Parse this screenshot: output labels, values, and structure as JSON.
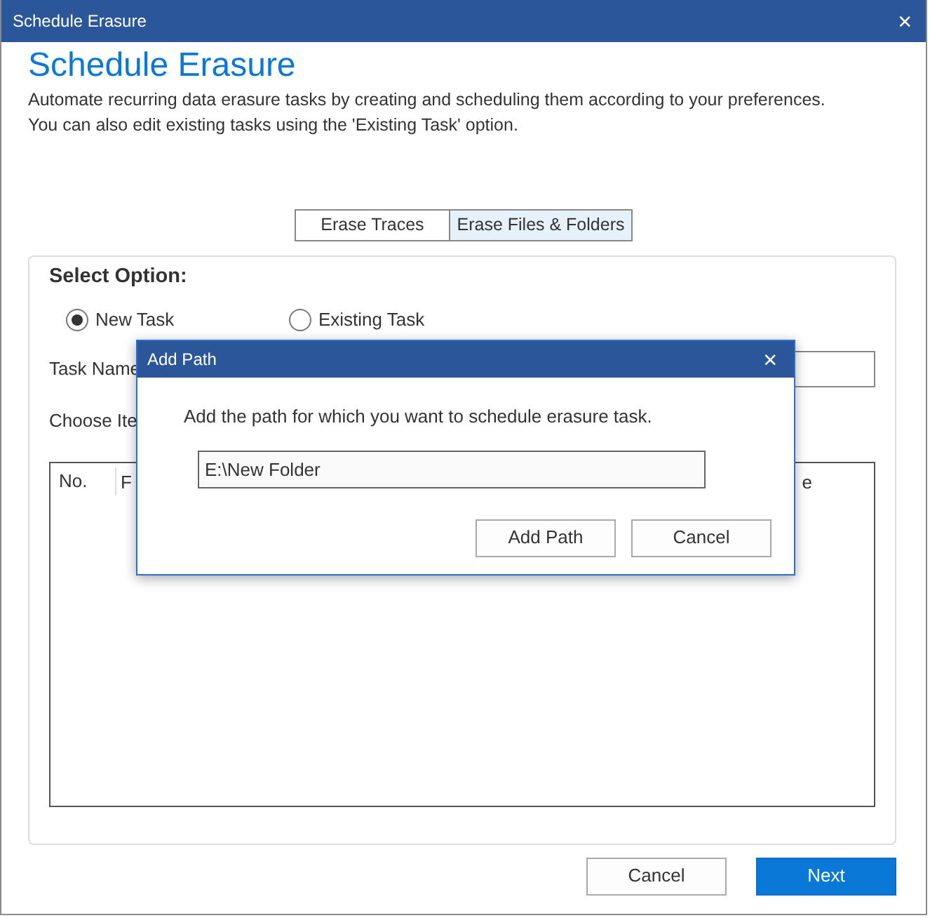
{
  "window": {
    "title": "Schedule Erasure",
    "close": "×"
  },
  "heading": "Schedule Erasure",
  "description": [
    "Automate recurring data erasure tasks by creating and scheduling them according to your preferences.",
    "You can also edit existing tasks using the 'Existing Task' option."
  ],
  "tabs": [
    {
      "label": "Erase Traces",
      "selected": false
    },
    {
      "label": "Erase Files & Folders",
      "selected": true
    }
  ],
  "panel": {
    "title": "Select Option:",
    "options": [
      {
        "label": "New Task",
        "selected": true
      },
      {
        "label": "Existing Task",
        "selected": false
      }
    ],
    "task_name_label": "Task Name",
    "choose_label": "Choose Ite",
    "table": {
      "columns": [
        "No.",
        "F",
        "e"
      ]
    }
  },
  "buttons": [
    {
      "label": "Cancel",
      "kind": "secondary"
    },
    {
      "label": "Next",
      "kind": "primary"
    }
  ],
  "dialog": {
    "title": "Add Path",
    "close": "×",
    "message": "Add the path for which you want to schedule erasure task.",
    "path": "E:\\New Folder",
    "buttons": [
      {
        "label": "Add Path"
      },
      {
        "label": "Cancel"
      }
    ]
  }
}
